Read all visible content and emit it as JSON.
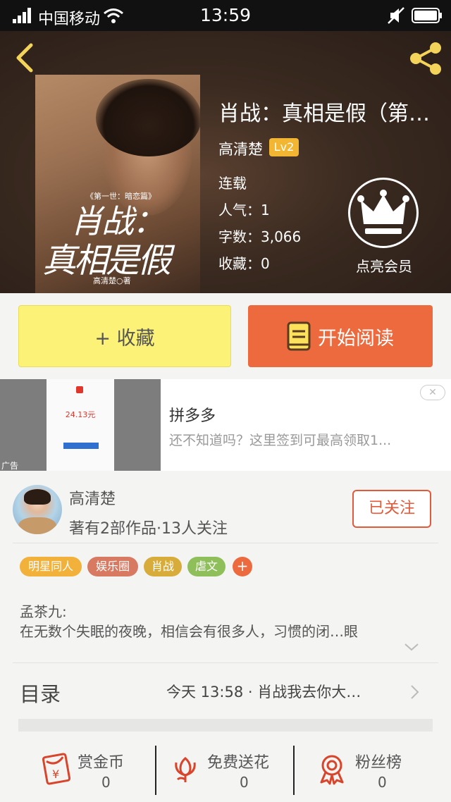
{
  "status_bar": {
    "carrier": "中国移动",
    "time": "13:59"
  },
  "book": {
    "title": "肖战：真相是假（第…",
    "author": "高清楚",
    "level": "Lv2",
    "status": "连载",
    "popularity_label": "人气：",
    "popularity_value": "1",
    "words_label": "字数：",
    "words_value": "3,066",
    "favorites_label": "收藏：",
    "favorites_value": "0",
    "vip_label": "点亮会员",
    "cover": {
      "subtitle": "《第一世：暗恋篇》",
      "title_line1": "肖战：",
      "title_line2": "真相是假",
      "author": "高清楚○著"
    }
  },
  "actions": {
    "favorite_label": "+ 收藏",
    "read_label": "开始阅读"
  },
  "ad": {
    "amount": "24.13元",
    "tag": "广告",
    "name": "拼多多",
    "description": "还不知道吗？这里签到可最高领取1..."
  },
  "author_info": {
    "name": "高清楚",
    "info": "著有2部作品·13人关注",
    "follow_label": "已关注"
  },
  "tags": [
    {
      "label": "明星同人",
      "color": "#f2b13a"
    },
    {
      "label": "娱乐圈",
      "color": "#d87a62"
    },
    {
      "label": "肖战",
      "color": "#d8ac3a"
    },
    {
      "label": "虐文",
      "color": "#8fbf5a"
    }
  ],
  "tag_add": "+",
  "intro": {
    "name": "孟茶九:",
    "text": "在无数个失眠的夜晚，相信会有很多人，习惯的闭…眼"
  },
  "toc": {
    "label": "目录",
    "latest": "今天 13:58 · 肖战我去你大…"
  },
  "stats": {
    "coins_label": "赏金币",
    "coins_value": "0",
    "flowers_label": "免费送花",
    "flowers_value": "0",
    "fans_label": "粉丝榜",
    "fans_value": "0"
  },
  "colors": {
    "accent": "#ec6a3d",
    "fav_button": "#fcf277",
    "follow": "#e25a3a",
    "level_badge": "#f3b633"
  },
  "icons": [
    "signal-icon",
    "wifi-icon",
    "mute-icon",
    "battery-icon",
    "back-icon",
    "share-icon",
    "crown-icon",
    "book-icon",
    "close-icon",
    "chevron-down-icon",
    "chevron-right-icon",
    "red-envelope-icon",
    "flower-icon",
    "medal-icon"
  ]
}
